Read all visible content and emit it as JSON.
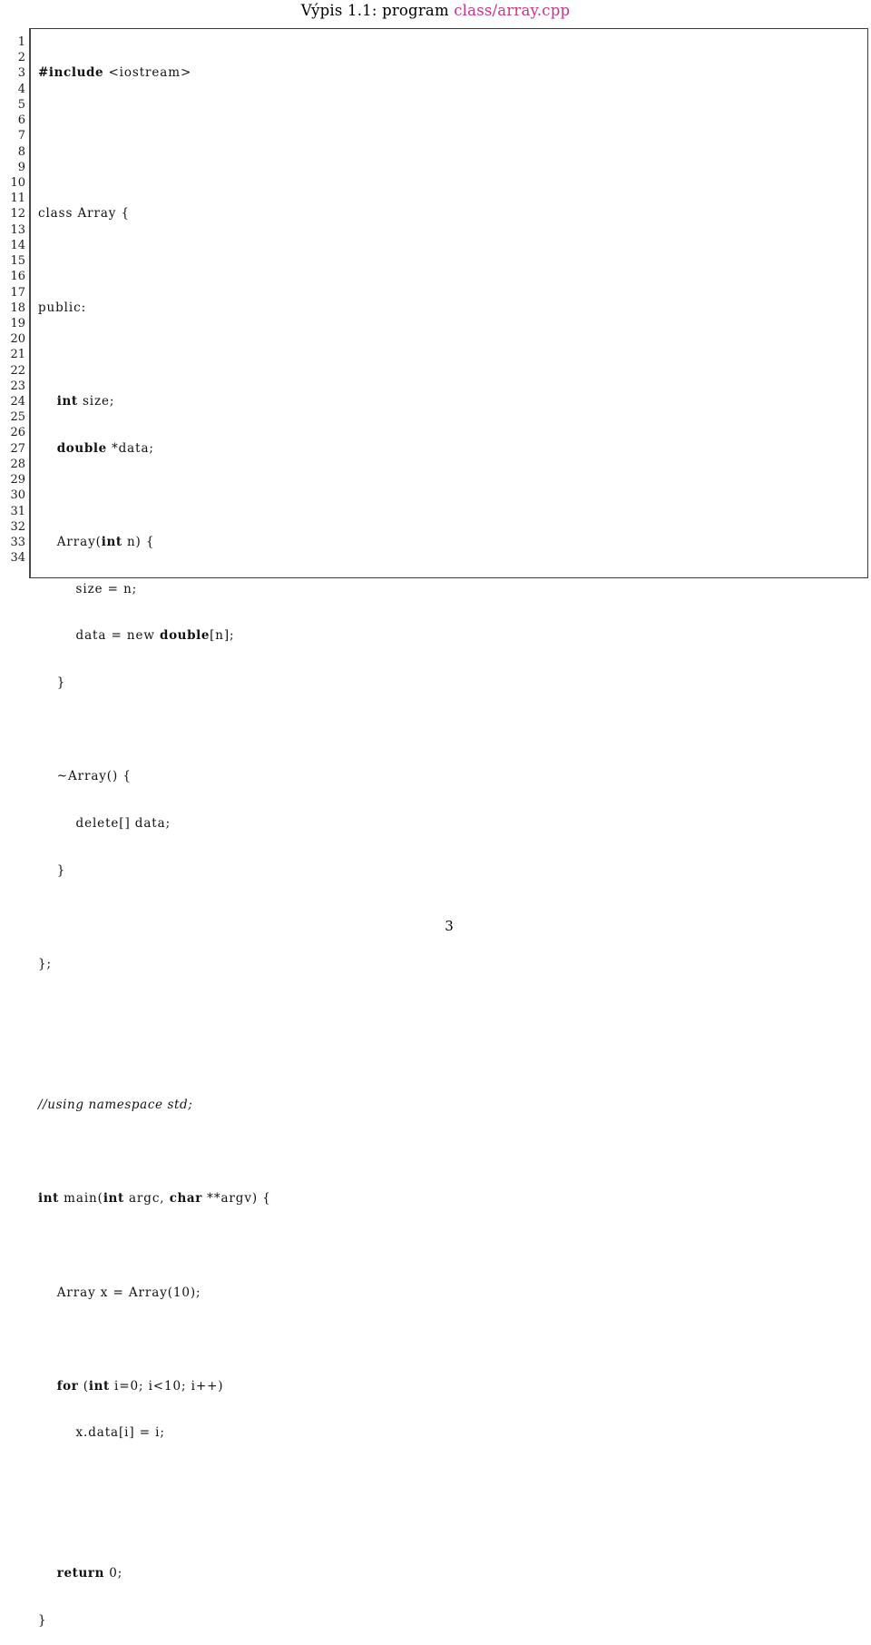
{
  "caption": {
    "label": "Výpis 1.1: program ",
    "filename": "class/array.cpp",
    "filename_color": "#cc3388"
  },
  "listing": {
    "language": "C++",
    "first_line_number": 1,
    "last_line_number": 34,
    "line_numbers": [
      "1",
      "2",
      "3",
      "4",
      "5",
      "6",
      "7",
      "8",
      "9",
      "10",
      "11",
      "12",
      "13",
      "14",
      "15",
      "16",
      "17",
      "18",
      "19",
      "20",
      "21",
      "22",
      "23",
      "24",
      "25",
      "26",
      "27",
      "28",
      "29",
      "30",
      "31",
      "32",
      "33",
      "34"
    ],
    "lines": [
      {
        "n": "1",
        "text": "#include <iostream>",
        "style": "keyword-line"
      },
      {
        "n": "2",
        "text": "",
        "style": "plain"
      },
      {
        "n": "3",
        "text": "",
        "style": "plain"
      },
      {
        "n": "4",
        "text": "class Array {",
        "style": "plain"
      },
      {
        "n": "5",
        "text": "",
        "style": "plain"
      },
      {
        "n": "6",
        "text": "public:",
        "style": "plain"
      },
      {
        "n": "7",
        "text": "",
        "style": "plain"
      },
      {
        "n": "8",
        "text": "    int size;",
        "style": "mixed"
      },
      {
        "n": "9",
        "text": "    double *data;",
        "style": "mixed"
      },
      {
        "n": "10",
        "text": "",
        "style": "plain"
      },
      {
        "n": "11",
        "text": "    Array(int n) {",
        "style": "mixed"
      },
      {
        "n": "12",
        "text": "        size = n;",
        "style": "plain"
      },
      {
        "n": "13",
        "text": "        data = new double[n];",
        "style": "mixed"
      },
      {
        "n": "14",
        "text": "    }",
        "style": "plain"
      },
      {
        "n": "15",
        "text": "",
        "style": "plain"
      },
      {
        "n": "16",
        "text": "    ~Array() {",
        "style": "plain"
      },
      {
        "n": "17",
        "text": "        delete[] data;",
        "style": "plain"
      },
      {
        "n": "18",
        "text": "    }",
        "style": "plain"
      },
      {
        "n": "19",
        "text": "",
        "style": "plain"
      },
      {
        "n": "20",
        "text": "};",
        "style": "plain"
      },
      {
        "n": "21",
        "text": "",
        "style": "plain"
      },
      {
        "n": "22",
        "text": "",
        "style": "plain"
      },
      {
        "n": "23",
        "text": "//using namespace std;",
        "style": "comment"
      },
      {
        "n": "24",
        "text": "",
        "style": "plain"
      },
      {
        "n": "25",
        "text": "int main(int argc, char **argv) {",
        "style": "mixed"
      },
      {
        "n": "26",
        "text": "",
        "style": "plain"
      },
      {
        "n": "27",
        "text": "    Array x = Array(10);",
        "style": "plain"
      },
      {
        "n": "28",
        "text": "",
        "style": "plain"
      },
      {
        "n": "29",
        "text": "    for (int i=0; i<10; i++)",
        "style": "mixed"
      },
      {
        "n": "30",
        "text": "        x.data[i] = i;",
        "style": "plain"
      },
      {
        "n": "31",
        "text": "",
        "style": "plain"
      },
      {
        "n": "32",
        "text": "",
        "style": "plain"
      },
      {
        "n": "33",
        "text": "    return 0;",
        "style": "mixed"
      },
      {
        "n": "34",
        "text": "}",
        "style": "plain"
      }
    ],
    "keywords_bold": [
      "#include",
      "int",
      "double",
      "char",
      "for",
      "return"
    ]
  },
  "footer": {
    "page_number": "3"
  }
}
